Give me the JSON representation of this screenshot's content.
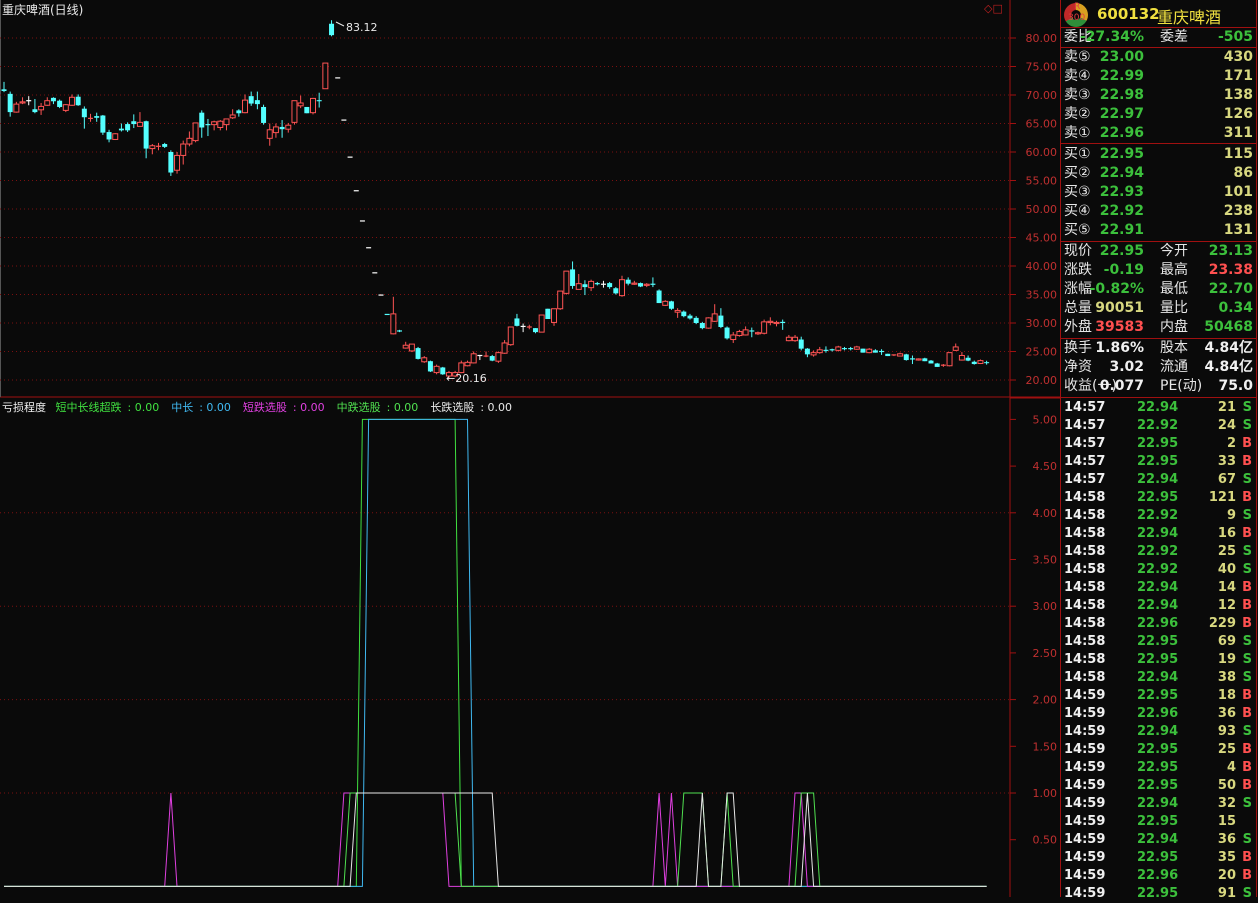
{
  "chart_title": "重庆啤酒(日线)",
  "colors": {
    "up": "#ff5454",
    "down": "#54ffff",
    "flat": "#ffffff",
    "axis": "#c03030",
    "grid": "#7a1010"
  },
  "price_axis": {
    "ticks": [
      "80.00",
      "75.00",
      "70.00",
      "65.00",
      "60.00",
      "55.00",
      "50.00",
      "45.00",
      "40.00",
      "35.00",
      "30.00",
      "25.00",
      "20.00"
    ],
    "max": 80,
    "min": 20
  },
  "annotations": {
    "high_label": "83.12",
    "low_label": "←20.16"
  },
  "tool_icons": [
    "diamond-icon",
    "square-icon"
  ],
  "candles": [
    [
      71.0,
      72.3,
      70.5,
      70.7
    ],
    [
      70.2,
      70.6,
      66.2,
      67.0
    ],
    [
      67.0,
      68.8,
      66.9,
      68.4
    ],
    [
      68.6,
      69.6,
      68.4,
      68.8
    ],
    [
      69.0,
      69.8,
      68.2,
      69.0
    ],
    [
      67.5,
      69.3,
      66.8,
      67.0
    ],
    [
      67.4,
      68.6,
      66.5,
      68.0
    ],
    [
      68.2,
      69.6,
      68.1,
      69.0
    ],
    [
      69.5,
      69.6,
      68.4,
      68.9
    ],
    [
      69.0,
      69.2,
      67.7,
      67.9
    ],
    [
      67.3,
      68.4,
      67.0,
      68.3
    ],
    [
      68.2,
      70.1,
      68.1,
      69.6
    ],
    [
      69.7,
      70.1,
      68.1,
      68.2
    ],
    [
      67.6,
      68.0,
      64.1,
      66.1
    ],
    [
      65.8,
      66.7,
      65.3,
      65.9
    ],
    [
      66.3,
      66.9,
      65.3,
      66.0
    ],
    [
      66.4,
      66.5,
      63.0,
      63.4
    ],
    [
      63.5,
      63.9,
      61.7,
      62.2
    ],
    [
      62.2,
      63.3,
      62.1,
      63.2
    ],
    [
      64.1,
      65.0,
      63.6,
      63.8
    ],
    [
      64.9,
      65.2,
      63.5,
      63.8
    ],
    [
      65.4,
      66.6,
      64.2,
      64.9
    ],
    [
      64.5,
      67.0,
      64.5,
      65.2
    ],
    [
      65.4,
      65.5,
      58.9,
      60.6
    ],
    [
      60.6,
      61.4,
      59.6,
      61.1
    ],
    [
      60.9,
      61.6,
      60.3,
      61.0
    ],
    [
      61.4,
      61.6,
      60.7,
      60.9
    ],
    [
      60.0,
      60.3,
      55.8,
      56.4
    ],
    [
      56.8,
      60.0,
      56.2,
      59.4
    ],
    [
      59.4,
      62.0,
      57.8,
      61.4
    ],
    [
      61.4,
      63.6,
      61.0,
      62.4
    ],
    [
      62.0,
      65.1,
      61.7,
      65.1
    ],
    [
      66.9,
      67.3,
      62.5,
      64.3
    ],
    [
      64.9,
      65.8,
      62.8,
      64.7
    ],
    [
      64.8,
      65.5,
      63.8,
      65.3
    ],
    [
      64.3,
      65.6,
      63.8,
      65.4
    ],
    [
      64.8,
      65.8,
      63.8,
      65.8
    ],
    [
      66.0,
      67.5,
      65.8,
      66.5
    ],
    [
      67.3,
      67.5,
      66.2,
      66.8
    ],
    [
      66.9,
      70.1,
      66.8,
      69.1
    ],
    [
      69.8,
      70.6,
      68.1,
      68.5
    ],
    [
      69.1,
      70.6,
      67.5,
      68.4
    ],
    [
      67.9,
      68.3,
      64.8,
      65.1
    ],
    [
      62.4,
      65.0,
      61.1,
      63.9
    ],
    [
      63.4,
      65.0,
      62.5,
      64.4
    ],
    [
      64.4,
      65.6,
      62.5,
      64.0
    ],
    [
      64.0,
      65.1,
      63.4,
      64.7
    ],
    [
      65.2,
      69.0,
      64.8,
      69.0
    ],
    [
      68.1,
      69.9,
      67.7,
      68.6
    ],
    [
      67.9,
      67.9,
      66.8,
      66.8
    ],
    [
      66.9,
      69.5,
      66.6,
      69.4
    ],
    [
      69.1,
      70.4,
      67.8,
      68.9
    ],
    [
      71.1,
      75.6,
      71.1,
      75.6
    ],
    [
      82.5,
      83.12,
      80.3,
      80.5
    ],
    [
      73.0,
      73.0,
      73.0,
      73.0
    ],
    [
      65.6,
      65.6,
      65.6,
      65.6
    ],
    [
      59.1,
      59.1,
      59.1,
      59.1
    ],
    [
      53.2,
      53.2,
      53.2,
      53.2
    ],
    [
      47.9,
      47.9,
      47.9,
      47.9
    ],
    [
      43.2,
      43.2,
      43.2,
      43.2
    ],
    [
      38.8,
      38.8,
      38.8,
      38.8
    ],
    [
      34.9,
      34.9,
      34.9,
      34.9
    ],
    [
      31.5,
      31.5,
      31.4,
      31.4
    ],
    [
      28.1,
      34.6,
      28.0,
      31.6
    ],
    [
      28.6,
      28.8,
      28.4,
      28.5
    ],
    [
      25.6,
      26.7,
      25.5,
      26.1
    ],
    [
      25.1,
      26.3,
      24.9,
      26.3
    ],
    [
      25.6,
      25.8,
      23.6,
      23.7
    ],
    [
      23.2,
      24.2,
      23.0,
      23.9
    ],
    [
      23.3,
      23.4,
      21.4,
      21.5
    ],
    [
      21.3,
      22.7,
      21.0,
      22.4
    ],
    [
      22.2,
      22.3,
      20.9,
      21.0
    ],
    [
      20.7,
      21.6,
      20.16,
      21.3
    ],
    [
      20.7,
      21.6,
      20.5,
      21.3
    ],
    [
      21.3,
      23.4,
      21.2,
      23.0
    ],
    [
      22.5,
      23.4,
      22.4,
      23.1
    ],
    [
      23.0,
      25.0,
      22.9,
      24.6
    ],
    [
      24.3,
      24.4,
      23.5,
      24.3
    ],
    [
      24.1,
      25.0,
      24.0,
      24.2
    ],
    [
      24.2,
      24.4,
      23.3,
      23.4
    ],
    [
      23.3,
      25.0,
      23.0,
      24.8
    ],
    [
      24.7,
      27.0,
      24.6,
      26.5
    ],
    [
      26.2,
      29.3,
      26.0,
      29.3
    ],
    [
      30.8,
      31.6,
      29.4,
      29.5
    ],
    [
      29.4,
      29.9,
      28.4,
      29.4
    ],
    [
      29.2,
      29.7,
      28.9,
      29.3
    ],
    [
      29.1,
      29.1,
      28.2,
      28.4
    ],
    [
      28.4,
      31.4,
      28.4,
      31.4
    ],
    [
      32.5,
      32.5,
      30.7,
      30.7
    ],
    [
      30.1,
      32.5,
      29.5,
      32.5
    ],
    [
      32.5,
      35.6,
      32.3,
      35.6
    ],
    [
      35.2,
      39.1,
      35.0,
      39.1
    ],
    [
      39.4,
      40.8,
      36.0,
      36.5
    ],
    [
      35.9,
      38.6,
      35.9,
      36.9
    ],
    [
      36.8,
      37.5,
      34.9,
      36.3
    ],
    [
      36.2,
      37.6,
      35.6,
      37.3
    ],
    [
      36.9,
      37.2,
      36.6,
      36.8
    ],
    [
      36.8,
      37.4,
      36.2,
      36.8
    ],
    [
      37.0,
      37.2,
      36.0,
      36.3
    ],
    [
      36.1,
      36.3,
      35.0,
      35.2
    ],
    [
      34.8,
      38.3,
      34.6,
      37.6
    ],
    [
      37.6,
      38.0,
      36.6,
      36.9
    ],
    [
      36.8,
      37.4,
      36.7,
      37.0
    ],
    [
      37.0,
      37.1,
      36.3,
      36.4
    ],
    [
      36.6,
      37.0,
      36.3,
      36.8
    ],
    [
      36.8,
      38.0,
      36.3,
      36.7
    ],
    [
      35.7,
      35.9,
      33.5,
      33.5
    ],
    [
      33.1,
      34.0,
      33.0,
      33.8
    ],
    [
      33.8,
      33.9,
      32.3,
      32.5
    ],
    [
      31.9,
      32.6,
      30.9,
      32.2
    ],
    [
      32.0,
      32.2,
      31.0,
      31.2
    ],
    [
      31.3,
      31.6,
      30.6,
      30.8
    ],
    [
      30.9,
      31.2,
      29.8,
      30.0
    ],
    [
      30.0,
      30.2,
      28.9,
      29.1
    ],
    [
      29.1,
      31.0,
      29.0,
      30.9
    ],
    [
      30.3,
      33.3,
      30.2,
      31.6
    ],
    [
      31.3,
      32.6,
      29.1,
      29.3
    ],
    [
      29.2,
      29.4,
      27.1,
      27.3
    ],
    [
      27.1,
      28.4,
      26.5,
      27.9
    ],
    [
      27.8,
      28.8,
      27.6,
      28.5
    ],
    [
      27.9,
      29.4,
      27.8,
      28.8
    ],
    [
      28.7,
      29.2,
      27.5,
      28.5
    ],
    [
      28.1,
      28.5,
      27.9,
      28.3
    ],
    [
      28.2,
      30.6,
      28.0,
      30.2
    ],
    [
      30.1,
      31.0,
      29.6,
      30.3
    ],
    [
      29.9,
      30.4,
      29.4,
      30.1
    ],
    [
      30.1,
      30.6,
      28.8,
      30.0
    ],
    [
      26.9,
      27.9,
      26.8,
      27.5
    ],
    [
      26.9,
      27.9,
      26.7,
      27.5
    ],
    [
      27.1,
      27.6,
      25.2,
      25.5
    ],
    [
      25.5,
      25.6,
      24.0,
      24.5
    ],
    [
      24.4,
      25.2,
      24.1,
      24.8
    ],
    [
      24.8,
      25.8,
      24.6,
      25.3
    ],
    [
      25.3,
      25.9,
      24.8,
      25.1
    ],
    [
      25.3,
      25.5,
      25.0,
      25.2
    ],
    [
      25.2,
      26.0,
      25.0,
      25.8
    ],
    [
      25.6,
      25.8,
      25.2,
      25.4
    ],
    [
      25.6,
      25.8,
      25.2,
      25.4
    ],
    [
      25.4,
      26.0,
      25.3,
      25.8
    ],
    [
      25.5,
      25.5,
      24.8,
      24.8
    ],
    [
      24.8,
      25.6,
      24.7,
      25.4
    ],
    [
      25.2,
      25.4,
      24.8,
      24.8
    ],
    [
      25.0,
      25.4,
      24.4,
      24.9
    ],
    [
      24.6,
      24.6,
      24.2,
      24.2
    ],
    [
      24.3,
      24.5,
      24.2,
      24.4
    ],
    [
      24.2,
      24.8,
      24.2,
      24.6
    ],
    [
      24.5,
      24.6,
      23.4,
      23.5
    ],
    [
      23.7,
      24.3,
      22.8,
      23.6
    ],
    [
      23.5,
      23.8,
      23.4,
      23.7
    ],
    [
      23.8,
      23.9,
      23.3,
      23.3
    ],
    [
      23.4,
      23.5,
      22.9,
      22.9
    ],
    [
      22.9,
      23.0,
      22.3,
      22.3
    ],
    [
      22.5,
      22.8,
      22.3,
      22.6
    ],
    [
      22.5,
      24.8,
      22.4,
      24.8
    ],
    [
      25.2,
      26.4,
      25.1,
      25.8
    ],
    [
      23.5,
      24.9,
      23.4,
      24.3
    ],
    [
      23.9,
      24.3,
      23.3,
      23.4
    ],
    [
      23.2,
      23.4,
      22.7,
      22.8
    ],
    [
      22.9,
      23.6,
      22.8,
      23.4
    ],
    [
      23.13,
      23.38,
      22.7,
      22.95
    ]
  ],
  "indicator": {
    "name": "亏损程度",
    "axis_ticks": [
      "5.00",
      "4.50",
      "4.00",
      "3.50",
      "3.00",
      "2.50",
      "2.00",
      "1.50",
      "1.00",
      "0.50"
    ],
    "max": 5,
    "series": [
      {
        "name": "短中长线超跌",
        "value_label": "0.00",
        "color": "#40e040",
        "nonzero": [
          {
            "from": 58,
            "to": 73,
            "value": 5
          }
        ]
      },
      {
        "name": "中长",
        "value_label": "0.00",
        "color": "#40b8f0",
        "nonzero": [
          {
            "from": 59,
            "to": 75,
            "value": 5
          }
        ]
      },
      {
        "name": "短跌选股",
        "value_label": "0.00",
        "color": "#e040e0",
        "nonzero": [
          {
            "from": 27,
            "to": 27,
            "value": 1
          },
          {
            "from": 55,
            "to": 71,
            "value": 1
          },
          {
            "from": 106,
            "to": 106,
            "value": 1
          },
          {
            "from": 108,
            "to": 108,
            "value": 1
          },
          {
            "from": 128,
            "to": 129,
            "value": 1
          }
        ]
      },
      {
        "name": "中跌选股",
        "value_label": "0.00",
        "color": "#50e050",
        "nonzero": [
          {
            "from": 56,
            "to": 73,
            "value": 1
          },
          {
            "from": 110,
            "to": 113,
            "value": 1
          },
          {
            "from": 117,
            "to": 117,
            "value": 1
          },
          {
            "from": 129,
            "to": 131,
            "value": 1
          }
        ]
      },
      {
        "name": "长跌选股",
        "value_label": "0.00",
        "color": "#e8e8e8",
        "nonzero": [
          {
            "from": 57,
            "to": 79,
            "value": 1
          },
          {
            "from": 113,
            "to": 113,
            "value": 1
          },
          {
            "from": 117,
            "to": 118,
            "value": 1
          },
          {
            "from": 130,
            "to": 130,
            "value": 1
          }
        ]
      }
    ]
  },
  "quote": {
    "badge_r": "R",
    "badge_300": "300",
    "code": "600132",
    "name": "重庆啤酒",
    "weibi": {
      "label": "委比",
      "value": "-27.34%",
      "label2": "委差",
      "value2": "-505"
    },
    "asks": [
      {
        "label": "卖⑤",
        "price": "23.00",
        "vol": "430"
      },
      {
        "label": "卖④",
        "price": "22.99",
        "vol": "171"
      },
      {
        "label": "卖③",
        "price": "22.98",
        "vol": "138"
      },
      {
        "label": "卖②",
        "price": "22.97",
        "vol": "126"
      },
      {
        "label": "卖①",
        "price": "22.96",
        "vol": "311"
      }
    ],
    "bids": [
      {
        "label": "买①",
        "price": "22.95",
        "vol": "115"
      },
      {
        "label": "买②",
        "price": "22.94",
        "vol": "86"
      },
      {
        "label": "买③",
        "price": "22.93",
        "vol": "101"
      },
      {
        "label": "买④",
        "price": "22.92",
        "vol": "238"
      },
      {
        "label": "买⑤",
        "price": "22.91",
        "vol": "131"
      }
    ],
    "stats": [
      {
        "l1": "现价",
        "v1": "22.95",
        "c1": "g",
        "l2": "今开",
        "v2": "23.13",
        "c2": "g"
      },
      {
        "l1": "涨跌",
        "v1": "-0.19",
        "c1": "g",
        "l2": "最高",
        "v2": "23.38",
        "c2": "r"
      },
      {
        "l1": "涨幅",
        "v1": "-0.82%",
        "c1": "g",
        "l2": "最低",
        "v2": "22.70",
        "c2": "g"
      },
      {
        "l1": "总量",
        "v1": "90051",
        "c1": "y",
        "l2": "量比",
        "v2": "0.34",
        "c2": "g"
      },
      {
        "l1": "外盘",
        "v1": "39583",
        "c1": "r",
        "l2": "内盘",
        "v2": "50468",
        "c2": "g"
      }
    ],
    "fundamentals": [
      {
        "l1": "换手",
        "v1": "1.86%",
        "l2": "股本",
        "v2": "4.84亿"
      },
      {
        "l1": "净资",
        "v1": "3.02",
        "l2": "流通",
        "v2": "4.84亿"
      },
      {
        "l1": "收益(一)",
        "v1": "0.077",
        "l2": "PE(动)",
        "v2": "75.0"
      }
    ]
  },
  "ticks": [
    {
      "time": "14:57",
      "price": "22.94",
      "vol": "21",
      "bs": "S"
    },
    {
      "time": "14:57",
      "price": "22.92",
      "vol": "24",
      "bs": "S"
    },
    {
      "time": "14:57",
      "price": "22.95",
      "vol": "2",
      "bs": "B"
    },
    {
      "time": "14:57",
      "price": "22.95",
      "vol": "33",
      "bs": "B"
    },
    {
      "time": "14:57",
      "price": "22.94",
      "vol": "67",
      "bs": "S"
    },
    {
      "time": "14:58",
      "price": "22.95",
      "vol": "121",
      "bs": "B"
    },
    {
      "time": "14:58",
      "price": "22.92",
      "vol": "9",
      "bs": "S"
    },
    {
      "time": "14:58",
      "price": "22.94",
      "vol": "16",
      "bs": "B"
    },
    {
      "time": "14:58",
      "price": "22.92",
      "vol": "25",
      "bs": "S"
    },
    {
      "time": "14:58",
      "price": "22.92",
      "vol": "40",
      "bs": "S"
    },
    {
      "time": "14:58",
      "price": "22.94",
      "vol": "14",
      "bs": "B"
    },
    {
      "time": "14:58",
      "price": "22.94",
      "vol": "12",
      "bs": "B"
    },
    {
      "time": "14:58",
      "price": "22.96",
      "vol": "229",
      "bs": "B"
    },
    {
      "time": "14:58",
      "price": "22.95",
      "vol": "69",
      "bs": "S"
    },
    {
      "time": "14:58",
      "price": "22.95",
      "vol": "19",
      "bs": "S"
    },
    {
      "time": "14:58",
      "price": "22.94",
      "vol": "38",
      "bs": "S"
    },
    {
      "time": "14:59",
      "price": "22.95",
      "vol": "18",
      "bs": "B"
    },
    {
      "time": "14:59",
      "price": "22.96",
      "vol": "36",
      "bs": "B"
    },
    {
      "time": "14:59",
      "price": "22.94",
      "vol": "93",
      "bs": "S"
    },
    {
      "time": "14:59",
      "price": "22.95",
      "vol": "25",
      "bs": "B"
    },
    {
      "time": "14:59",
      "price": "22.95",
      "vol": "4",
      "bs": "B"
    },
    {
      "time": "14:59",
      "price": "22.95",
      "vol": "50",
      "bs": "B"
    },
    {
      "time": "14:59",
      "price": "22.94",
      "vol": "32",
      "bs": "S"
    },
    {
      "time": "14:59",
      "price": "22.95",
      "vol": "15",
      "bs": ""
    },
    {
      "time": "14:59",
      "price": "22.94",
      "vol": "36",
      "bs": "S"
    },
    {
      "time": "14:59",
      "price": "22.95",
      "vol": "35",
      "bs": "B"
    },
    {
      "time": "14:59",
      "price": "22.96",
      "vol": "20",
      "bs": "B"
    },
    {
      "time": "14:59",
      "price": "22.95",
      "vol": "91",
      "bs": "S"
    }
  ]
}
